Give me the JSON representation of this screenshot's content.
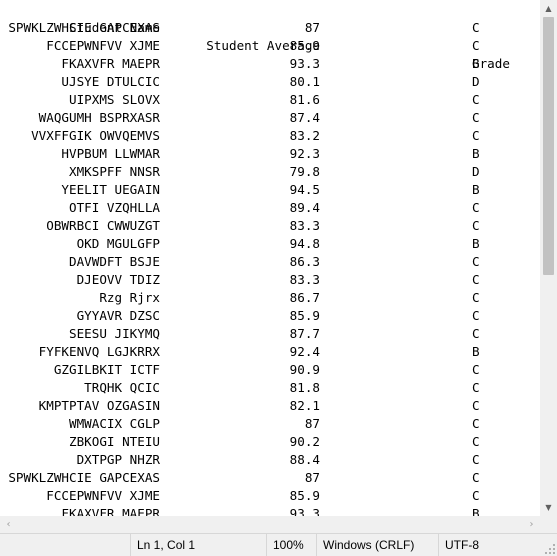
{
  "header": {
    "name": "Student Name",
    "avg": "Student Average",
    "grade": "Grade"
  },
  "rows": [
    {
      "name": "SPWKLZWHCIE GAPCEXAS",
      "avg": "87",
      "grade": "C"
    },
    {
      "name": "FCCEPWNFVV XJME",
      "avg": "85.9",
      "grade": "C"
    },
    {
      "name": "FKAXVFR MAEPR",
      "avg": "93.3",
      "grade": "B"
    },
    {
      "name": "UJSYE DTULCIC",
      "avg": "80.1",
      "grade": "D"
    },
    {
      "name": "UIPXMS SLOVX",
      "avg": "81.6",
      "grade": "C"
    },
    {
      "name": "WAQGUMH BSPRXASR",
      "avg": "87.4",
      "grade": "C"
    },
    {
      "name": "VVXFFGIK OWVQEMVS",
      "avg": "83.2",
      "grade": "C"
    },
    {
      "name": "HVPBUM LLWMAR",
      "avg": "92.3",
      "grade": "B"
    },
    {
      "name": "XMKSPFF NNSR",
      "avg": "79.8",
      "grade": "D"
    },
    {
      "name": "YEELIT UEGAIN",
      "avg": "94.5",
      "grade": "B"
    },
    {
      "name": "OTFI VZQHLLA",
      "avg": "89.4",
      "grade": "C"
    },
    {
      "name": "OBWRBCI CWWUZGT",
      "avg": "83.3",
      "grade": "C"
    },
    {
      "name": "OKD MGULGFP",
      "avg": "94.8",
      "grade": "B"
    },
    {
      "name": "DAVWDFT BSJE",
      "avg": "86.3",
      "grade": "C"
    },
    {
      "name": "DJEOVV TDIZ",
      "avg": "83.3",
      "grade": "C"
    },
    {
      "name": "Rzg Rjrx",
      "avg": "86.7",
      "grade": "C"
    },
    {
      "name": "GYYAVR DZSC",
      "avg": "85.9",
      "grade": "C"
    },
    {
      "name": "SEESU JIKYMQ",
      "avg": "87.7",
      "grade": "C"
    },
    {
      "name": "FYFKENVQ LGJKRRX",
      "avg": "92.4",
      "grade": "B"
    },
    {
      "name": "GZGILBKIT ICTF",
      "avg": "90.9",
      "grade": "C"
    },
    {
      "name": "TRQHK QCIC",
      "avg": "81.8",
      "grade": "C"
    },
    {
      "name": "KMPTPTAV OZGASIN",
      "avg": "82.1",
      "grade": "C"
    },
    {
      "name": "WMWACIX CGLP",
      "avg": "87",
      "grade": "C"
    },
    {
      "name": "ZBKOGI NTEIU",
      "avg": "90.2",
      "grade": "C"
    },
    {
      "name": "DXTPGP NHZR",
      "avg": "88.4",
      "grade": "C"
    },
    {
      "name": "SPWKLZWHCIE GAPCEXAS",
      "avg": "87",
      "grade": "C"
    },
    {
      "name": "FCCEPWNFVV XJME",
      "avg": "85.9",
      "grade": "C"
    },
    {
      "name": "FKAXVFR MAEPR",
      "avg": "93.3",
      "grade": "B"
    }
  ],
  "status": {
    "position": "Ln 1, Col 1",
    "zoom": "100%",
    "line_ending": "Windows (CRLF)",
    "encoding": "UTF-8"
  },
  "icons": {
    "scroll_up": "chevron-up-icon",
    "scroll_down": "chevron-down-icon",
    "scroll_left": "chevron-left-icon",
    "scroll_right": "chevron-right-icon",
    "resize": "resize-grip-icon"
  },
  "colors": {
    "background": "#ffffff",
    "text": "#000000",
    "chrome": "#f0f0f0",
    "thumb": "#c2c2c2"
  }
}
